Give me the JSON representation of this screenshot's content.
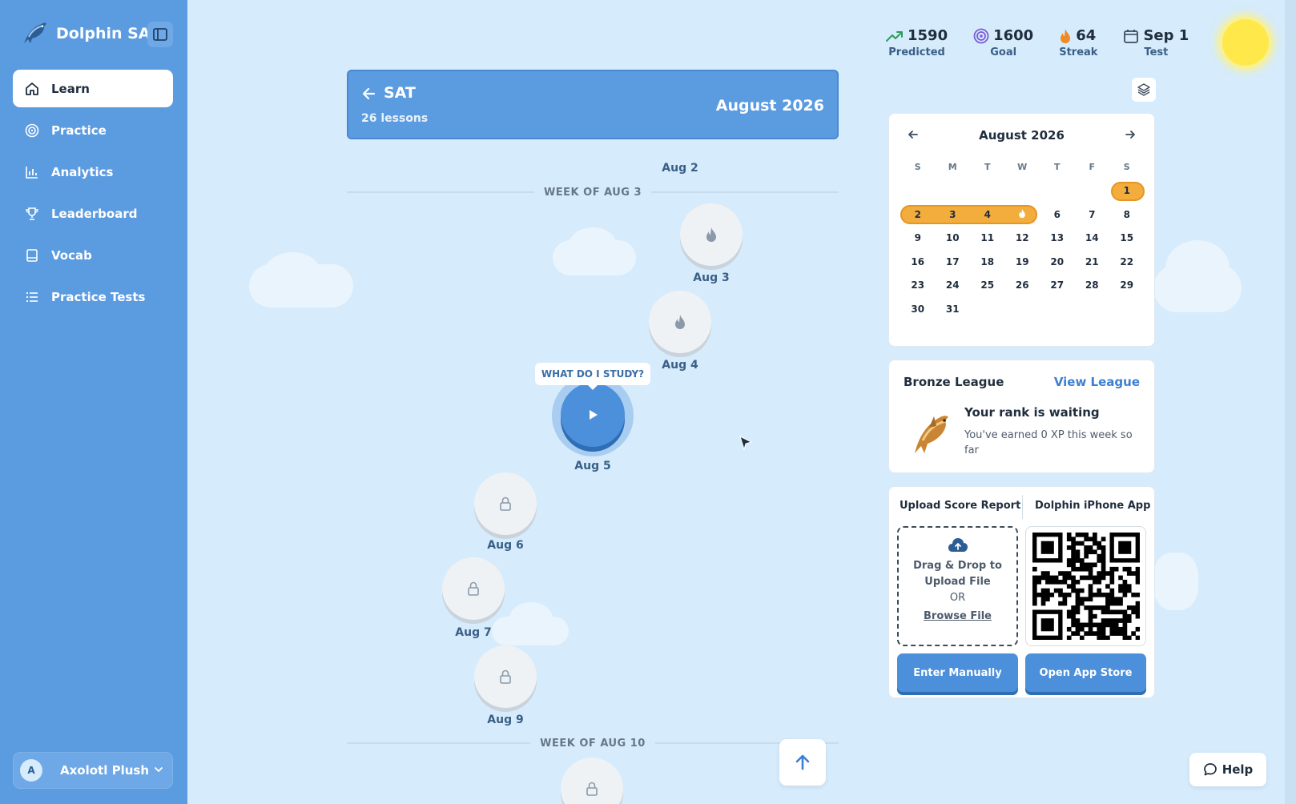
{
  "app": {
    "name": "Dolphin SAT"
  },
  "sidebar": {
    "items": [
      {
        "label": "Learn",
        "icon": "home-icon",
        "active": true
      },
      {
        "label": "Practice",
        "icon": "target-icon"
      },
      {
        "label": "Analytics",
        "icon": "bar-chart-icon"
      },
      {
        "label": "Leaderboard",
        "icon": "trophy-icon"
      },
      {
        "label": "Vocab",
        "icon": "book-icon"
      },
      {
        "label": "Practice Tests",
        "icon": "list-icon"
      }
    ],
    "user": {
      "initial": "A",
      "name": "Axolotl Plush"
    }
  },
  "course": {
    "title": "SAT",
    "lessons": "26 lessons",
    "month": "August 2026"
  },
  "path": {
    "weeks": [
      "WEEK OF AUG 3",
      "WEEK OF AUG 10"
    ],
    "nodes": [
      {
        "label": "Aug 2",
        "state": "completed"
      },
      {
        "label": "Aug 3",
        "state": "completed",
        "icon": "flame-icon"
      },
      {
        "label": "Aug 4",
        "state": "completed",
        "icon": "flame-icon"
      },
      {
        "label": "Aug 5",
        "state": "active",
        "icon": "play-icon"
      },
      {
        "label": "Aug 6",
        "state": "locked",
        "icon": "lock-icon"
      },
      {
        "label": "Aug 7",
        "state": "locked",
        "icon": "lock-icon"
      },
      {
        "label": "Aug 9",
        "state": "locked",
        "icon": "lock-icon"
      }
    ],
    "tooltip": "WHAT DO I STUDY?"
  },
  "stats": [
    {
      "value": "1590",
      "label": "Predicted",
      "icon": "trending-up-icon",
      "color": "#2e9c5a"
    },
    {
      "value": "1600",
      "label": "Goal",
      "icon": "target-icon",
      "color": "#7b5cd6"
    },
    {
      "value": "64",
      "label": "Streak",
      "icon": "flame-icon",
      "color": "#f08a24"
    },
    {
      "value": "Sep 1",
      "label": "Test",
      "icon": "calendar-icon",
      "color": "#3d4c5c"
    }
  ],
  "calendar": {
    "title": "August 2026",
    "dows": [
      "S",
      "M",
      "T",
      "W",
      "T",
      "F",
      "S"
    ],
    "weeks": [
      [
        "",
        "",
        "",
        "",
        "",
        "",
        "1"
      ],
      [
        "2",
        "3",
        "4",
        "",
        "6",
        "7",
        "8"
      ],
      [
        "9",
        "10",
        "11",
        "12",
        "13",
        "14",
        "15"
      ],
      [
        "16",
        "17",
        "18",
        "19",
        "20",
        "21",
        "22"
      ],
      [
        "23",
        "24",
        "25",
        "26",
        "27",
        "28",
        "29"
      ],
      [
        "30",
        "31",
        "",
        "",
        "",
        "",
        ""
      ]
    ],
    "streak_days": [
      "1",
      "2",
      "3",
      "4",
      "5"
    ],
    "today_icon": "flame-icon",
    "highlight_color": "#f3ad3c"
  },
  "league": {
    "title": "Bronze League",
    "link": "View League",
    "rank_title": "Your rank is waiting",
    "rank_sub": "You've earned 0 XP this week so far"
  },
  "upload": {
    "tab1": "Upload Score Report",
    "tab2": "Dolphin iPhone App",
    "drop_line1": "Drag & Drop to",
    "drop_line2": "Upload File",
    "or": "OR",
    "browse": "Browse File",
    "btn_manual": "Enter Manually",
    "btn_store": "Open App Store"
  },
  "help": {
    "label": "Help"
  },
  "colors": {
    "sidebar": "#5b9be0",
    "background": "#d6ebfb",
    "accent": "#4c8fdb"
  }
}
